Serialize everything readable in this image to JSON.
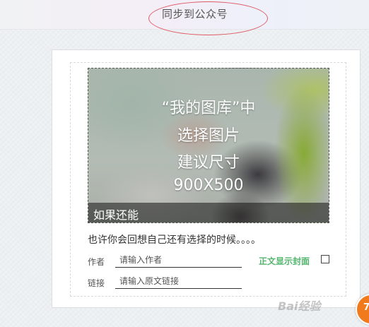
{
  "header": {
    "title": "同步到公众号"
  },
  "cover": {
    "hint_lines": [
      "“我的图库”中",
      "选择图片",
      "建议尺寸",
      "900X500"
    ],
    "caption": "如果还能"
  },
  "article": {
    "summary": "也许你会回想自己还有选择的时候。。。。",
    "author_label": "作者",
    "author_placeholder": "请输入作者",
    "link_label": "链接",
    "link_placeholder": "请输入原文链接",
    "show_cover_label": "正文显示封面",
    "show_cover_checked": false
  },
  "watermark": {
    "text": "Bai经验"
  },
  "float_button": {
    "text": "7"
  },
  "colors": {
    "accent_green": "#53b66e",
    "annotation_red": "#e05a65",
    "badge_orange": "#f07a1c"
  }
}
